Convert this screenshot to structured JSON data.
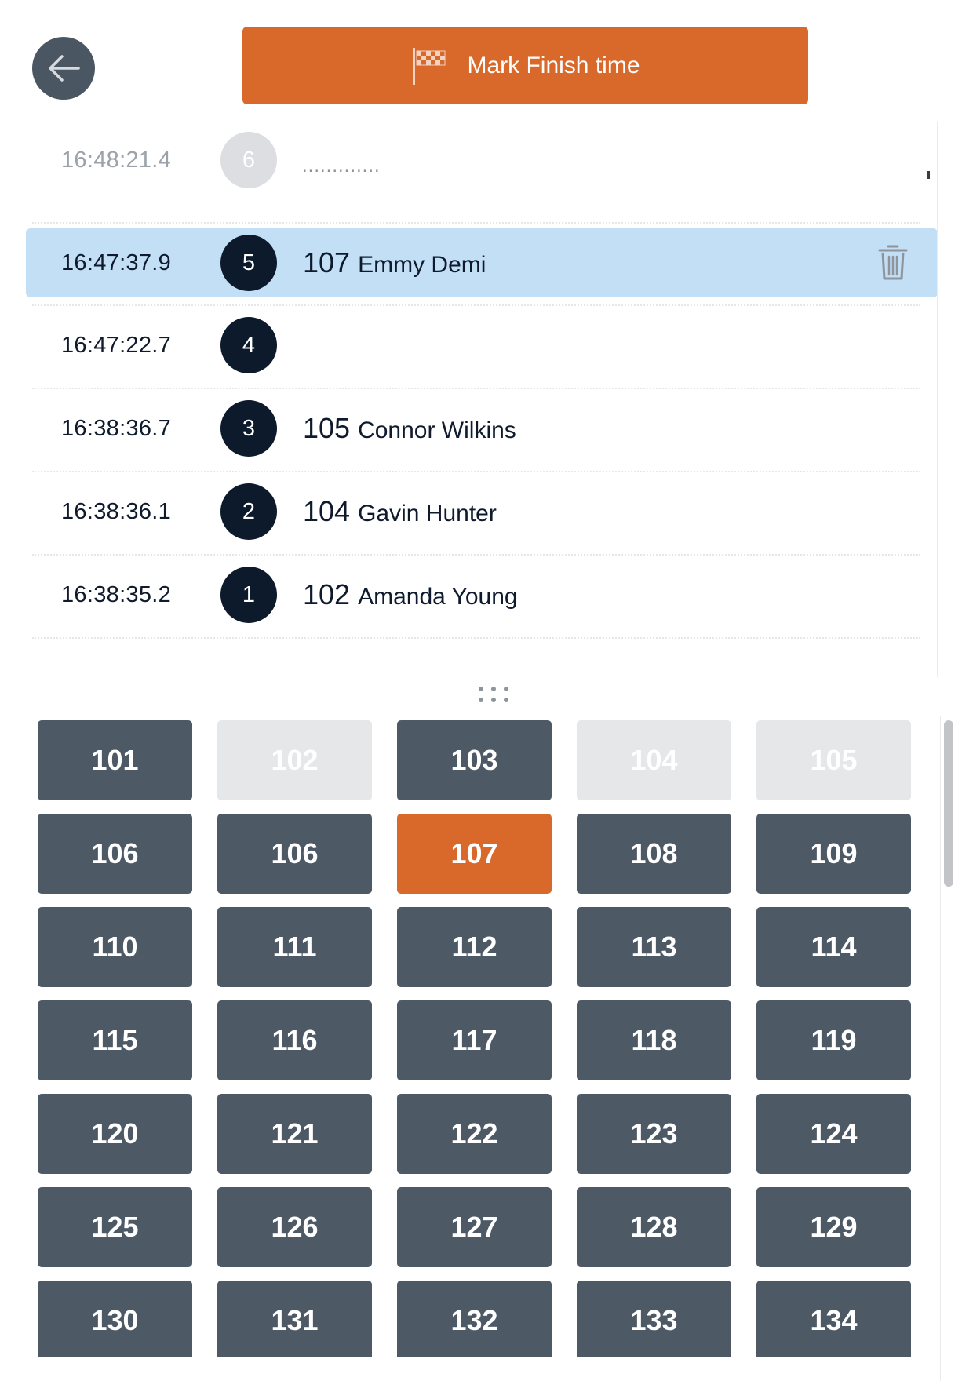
{
  "header": {
    "finish_button_label": "Mark Finish time",
    "back_icon": "arrow-left-icon",
    "finish_icon": "checkered-flag-icon"
  },
  "results": [
    {
      "time": "16:48:21.4",
      "place": "6",
      "status": "pending",
      "placeholder": ".............",
      "bib": "",
      "name": ""
    },
    {
      "time": "16:47:37.9",
      "place": "5",
      "status": "selected",
      "bib": "107",
      "name": "Emmy Demi"
    },
    {
      "time": "16:47:22.7",
      "place": "4",
      "status": "normal",
      "bib": "",
      "name": ""
    },
    {
      "time": "16:38:36.7",
      "place": "3",
      "status": "normal",
      "bib": "105",
      "name": "Connor Wilkins"
    },
    {
      "time": "16:38:36.1",
      "place": "2",
      "status": "normal",
      "bib": "104",
      "name": "Gavin Hunter"
    },
    {
      "time": "16:38:35.2",
      "place": "1",
      "status": "normal",
      "bib": "102",
      "name": "Amanda Young"
    }
  ],
  "bibs": [
    {
      "label": "101",
      "state": "available"
    },
    {
      "label": "102",
      "state": "used"
    },
    {
      "label": "103",
      "state": "available"
    },
    {
      "label": "104",
      "state": "used"
    },
    {
      "label": "105",
      "state": "used"
    },
    {
      "label": "106",
      "state": "available"
    },
    {
      "label": "106",
      "state": "available"
    },
    {
      "label": "107",
      "state": "active"
    },
    {
      "label": "108",
      "state": "available"
    },
    {
      "label": "109",
      "state": "available"
    },
    {
      "label": "110",
      "state": "available"
    },
    {
      "label": "111",
      "state": "available"
    },
    {
      "label": "112",
      "state": "available"
    },
    {
      "label": "113",
      "state": "available"
    },
    {
      "label": "114",
      "state": "available"
    },
    {
      "label": "115",
      "state": "available"
    },
    {
      "label": "116",
      "state": "available"
    },
    {
      "label": "117",
      "state": "available"
    },
    {
      "label": "118",
      "state": "available"
    },
    {
      "label": "119",
      "state": "available"
    },
    {
      "label": "120",
      "state": "available"
    },
    {
      "label": "121",
      "state": "available"
    },
    {
      "label": "122",
      "state": "available"
    },
    {
      "label": "123",
      "state": "available"
    },
    {
      "label": "124",
      "state": "available"
    },
    {
      "label": "125",
      "state": "available"
    },
    {
      "label": "126",
      "state": "available"
    },
    {
      "label": "127",
      "state": "available"
    },
    {
      "label": "128",
      "state": "available"
    },
    {
      "label": "129",
      "state": "available"
    },
    {
      "label": "130",
      "state": "available"
    },
    {
      "label": "131",
      "state": "available"
    },
    {
      "label": "132",
      "state": "available"
    },
    {
      "label": "133",
      "state": "available"
    },
    {
      "label": "134",
      "state": "available"
    }
  ],
  "colors": {
    "accent": "#d9682b",
    "bib_default": "#4e5966",
    "bib_used": "#e6e7e9",
    "selected_row": "#c2dff6",
    "badge": "#0c1a2b",
    "badge_pending": "#dcdee1"
  }
}
